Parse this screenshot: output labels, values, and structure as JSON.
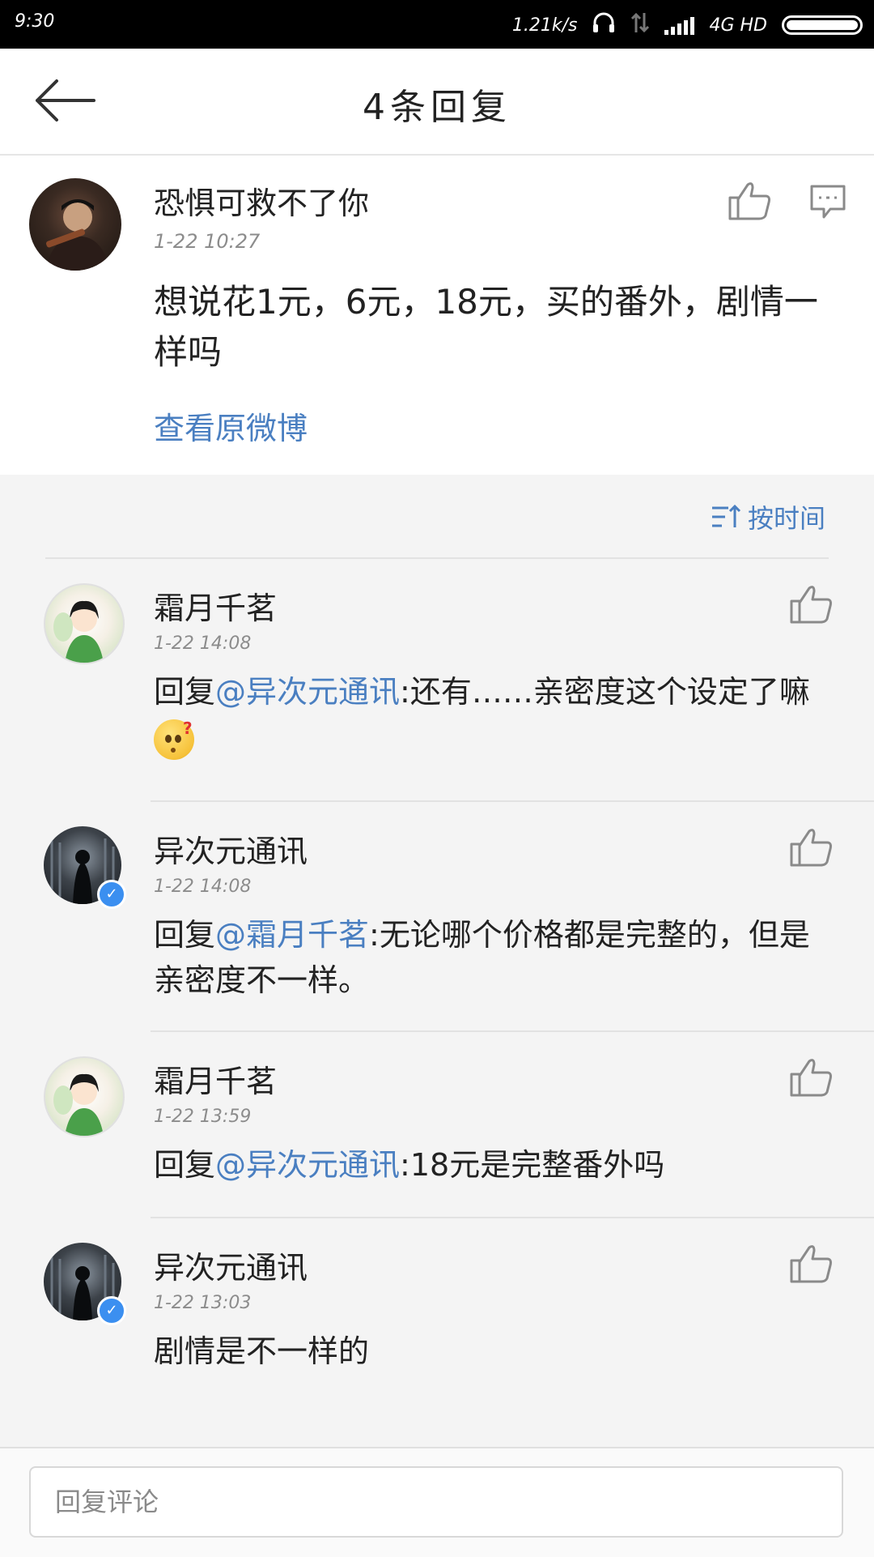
{
  "status_bar": {
    "time": "9:30",
    "speed": "1.21k/s",
    "network": "4G HD"
  },
  "header": {
    "title": "4条回复"
  },
  "main_comment": {
    "user": "恐惧可救不了你",
    "date": "1-22 10:27",
    "text": "想说花1元，6元，18元，买的番外，剧情一样吗",
    "link": "查看原微博"
  },
  "sort": {
    "label": "按时间"
  },
  "replies": [
    {
      "user": "霜月千茗",
      "date": "1-22 14:08",
      "prefix": "回复",
      "mention": "@异次元通讯",
      "text": ":还有……亲密度这个设定了嘛"
    },
    {
      "user": "异次元通讯",
      "date": "1-22 14:08",
      "prefix": "回复",
      "mention": "@霜月千茗",
      "text": ":无论哪个价格都是完整的，但是亲密度不一样。"
    },
    {
      "user": "霜月千茗",
      "date": "1-22 13:59",
      "prefix": "回复",
      "mention": "@异次元通讯",
      "text": ":18元是完整番外吗"
    },
    {
      "user": "异次元通讯",
      "date": "1-22 13:03",
      "text": "剧情是不一样的"
    }
  ],
  "bottom": {
    "placeholder": "回复评论"
  },
  "colors": {
    "accent": "#4a7fc1",
    "background": "#f4f4f4",
    "verified": "#3b8ff0"
  }
}
